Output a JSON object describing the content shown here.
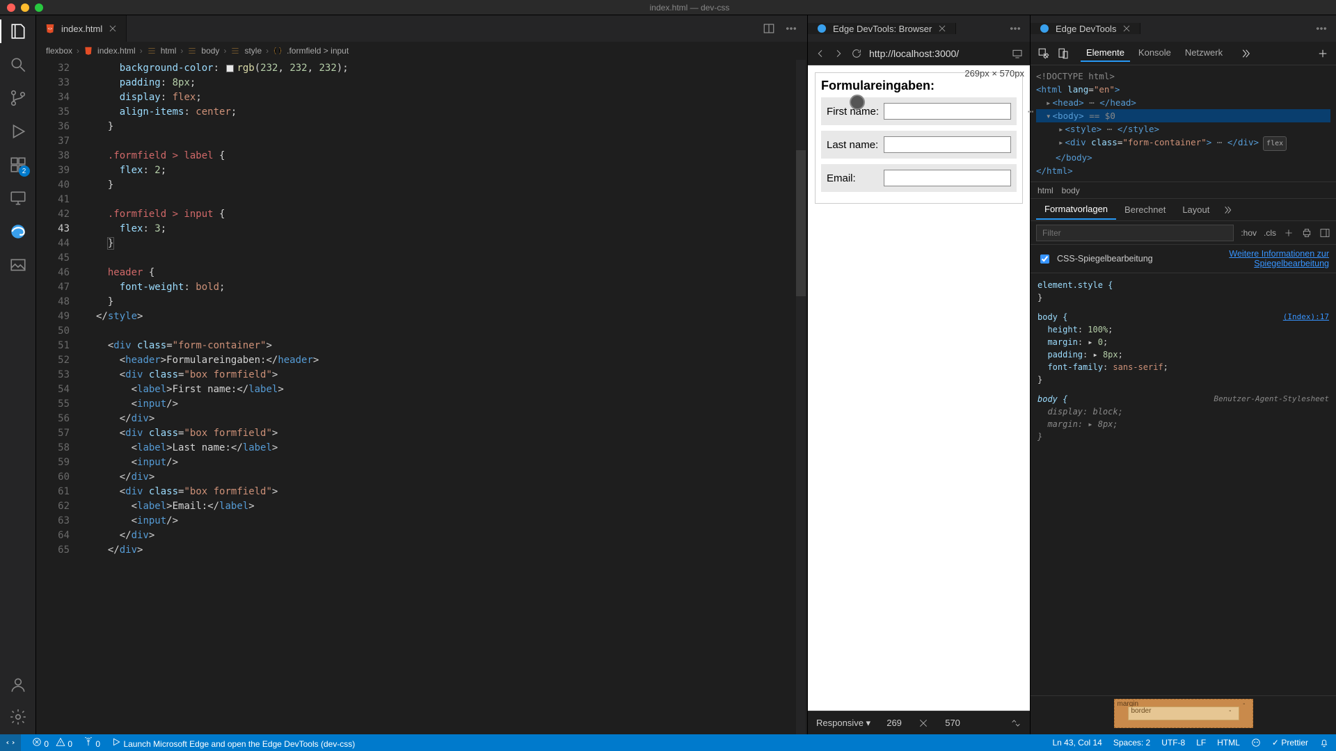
{
  "window": {
    "title": "index.html — dev-css"
  },
  "activitybar": {
    "extensions_badge": "2"
  },
  "editor": {
    "tab": {
      "filename": "index.html"
    },
    "breadcrumb": [
      "flexbox",
      "index.html",
      "html",
      "body",
      "style",
      ".formfield > input"
    ],
    "current_line": 43,
    "lines": {
      "32": [
        {
          "cls": "c-blue",
          "t": "background-color"
        },
        {
          "cls": "c-punc",
          "t": ": "
        },
        {
          "cls": "",
          "t": "",
          "colorbox": true
        },
        {
          "cls": "c-func",
          "t": "rgb"
        },
        {
          "cls": "c-punc",
          "t": "("
        },
        {
          "cls": "c-num",
          "t": "232"
        },
        {
          "cls": "c-punc",
          "t": ", "
        },
        {
          "cls": "c-num",
          "t": "232"
        },
        {
          "cls": "c-punc",
          "t": ", "
        },
        {
          "cls": "c-num",
          "t": "232"
        },
        {
          "cls": "c-punc",
          "t": ");"
        }
      ],
      "33": [
        {
          "cls": "c-blue",
          "t": "padding"
        },
        {
          "cls": "c-punc",
          "t": ": "
        },
        {
          "cls": "c-num",
          "t": "8px"
        },
        {
          "cls": "c-punc",
          "t": ";"
        }
      ],
      "34": [
        {
          "cls": "c-blue",
          "t": "display"
        },
        {
          "cls": "c-punc",
          "t": ": "
        },
        {
          "cls": "c-val",
          "t": "flex"
        },
        {
          "cls": "c-punc",
          "t": ";"
        }
      ],
      "35": [
        {
          "cls": "c-blue",
          "t": "align-items"
        },
        {
          "cls": "c-punc",
          "t": ": "
        },
        {
          "cls": "c-val",
          "t": "center"
        },
        {
          "cls": "c-punc",
          "t": ";"
        }
      ],
      "36": [
        {
          "cls": "c-punc",
          "t": "}"
        }
      ],
      "37": [],
      "38": [
        {
          "cls": "c-red",
          "t": ".formfield > label"
        },
        {
          "cls": "c-punc",
          "t": " {"
        }
      ],
      "39": [
        {
          "cls": "c-blue",
          "t": "flex"
        },
        {
          "cls": "c-punc",
          "t": ": "
        },
        {
          "cls": "c-num",
          "t": "2"
        },
        {
          "cls": "c-punc",
          "t": ";"
        }
      ],
      "40": [
        {
          "cls": "c-punc",
          "t": "}"
        }
      ],
      "41": [],
      "42": [
        {
          "cls": "c-red",
          "t": ".formfield > input"
        },
        {
          "cls": "c-punc",
          "t": " {"
        }
      ],
      "43": [
        {
          "cls": "c-blue",
          "t": "flex"
        },
        {
          "cls": "c-punc",
          "t": ": "
        },
        {
          "cls": "c-num",
          "t": "3"
        },
        {
          "cls": "c-punc",
          "t": ";"
        }
      ],
      "44": [
        {
          "cls": "c-punc sel-brace",
          "t": "}"
        }
      ],
      "45": [],
      "46": [
        {
          "cls": "c-red",
          "t": "header"
        },
        {
          "cls": "c-punc",
          "t": " {"
        }
      ],
      "47": [
        {
          "cls": "c-blue",
          "t": "font-weight"
        },
        {
          "cls": "c-punc",
          "t": ": "
        },
        {
          "cls": "c-val",
          "t": "bold"
        },
        {
          "cls": "c-punc",
          "t": ";"
        }
      ],
      "48": [
        {
          "cls": "c-punc",
          "t": "}"
        }
      ],
      "49": [
        {
          "cls": "c-punc",
          "t": "</"
        },
        {
          "cls": "c-tag",
          "t": "style"
        },
        {
          "cls": "c-punc",
          "t": ">"
        }
      ],
      "50": [],
      "51": [
        {
          "cls": "c-punc",
          "t": "<"
        },
        {
          "cls": "c-tag",
          "t": "div"
        },
        {
          "cls": "c-punc",
          "t": " "
        },
        {
          "cls": "c-blue",
          "t": "class"
        },
        {
          "cls": "c-punc",
          "t": "="
        },
        {
          "cls": "c-val",
          "t": "\"form-container\""
        },
        {
          "cls": "c-punc",
          "t": ">"
        }
      ],
      "52": [
        {
          "cls": "c-punc",
          "t": "<"
        },
        {
          "cls": "c-tag",
          "t": "header"
        },
        {
          "cls": "c-punc",
          "t": ">"
        },
        {
          "cls": "c-punc",
          "t": "Formulareingaben:"
        },
        {
          "cls": "c-punc",
          "t": "</"
        },
        {
          "cls": "c-tag",
          "t": "header"
        },
        {
          "cls": "c-punc",
          "t": ">"
        }
      ],
      "53": [
        {
          "cls": "c-punc",
          "t": "<"
        },
        {
          "cls": "c-tag",
          "t": "div"
        },
        {
          "cls": "c-punc",
          "t": " "
        },
        {
          "cls": "c-blue",
          "t": "class"
        },
        {
          "cls": "c-punc",
          "t": "="
        },
        {
          "cls": "c-val",
          "t": "\"box formfield\""
        },
        {
          "cls": "c-punc",
          "t": ">"
        }
      ],
      "54": [
        {
          "cls": "c-punc",
          "t": "<"
        },
        {
          "cls": "c-tag",
          "t": "label"
        },
        {
          "cls": "c-punc",
          "t": ">"
        },
        {
          "cls": "c-punc",
          "t": "First name:"
        },
        {
          "cls": "c-punc",
          "t": "</"
        },
        {
          "cls": "c-tag",
          "t": "label"
        },
        {
          "cls": "c-punc",
          "t": ">"
        }
      ],
      "55": [
        {
          "cls": "c-punc",
          "t": "<"
        },
        {
          "cls": "c-tag",
          "t": "input"
        },
        {
          "cls": "c-punc",
          "t": "/>"
        }
      ],
      "56": [
        {
          "cls": "c-punc",
          "t": "</"
        },
        {
          "cls": "c-tag",
          "t": "div"
        },
        {
          "cls": "c-punc",
          "t": ">"
        }
      ],
      "57": [
        {
          "cls": "c-punc",
          "t": "<"
        },
        {
          "cls": "c-tag",
          "t": "div"
        },
        {
          "cls": "c-punc",
          "t": " "
        },
        {
          "cls": "c-blue",
          "t": "class"
        },
        {
          "cls": "c-punc",
          "t": "="
        },
        {
          "cls": "c-val",
          "t": "\"box formfield\""
        },
        {
          "cls": "c-punc",
          "t": ">"
        }
      ],
      "58": [
        {
          "cls": "c-punc",
          "t": "<"
        },
        {
          "cls": "c-tag",
          "t": "label"
        },
        {
          "cls": "c-punc",
          "t": ">"
        },
        {
          "cls": "c-punc",
          "t": "Last name:"
        },
        {
          "cls": "c-punc",
          "t": "</"
        },
        {
          "cls": "c-tag",
          "t": "label"
        },
        {
          "cls": "c-punc",
          "t": ">"
        }
      ],
      "59": [
        {
          "cls": "c-punc",
          "t": "<"
        },
        {
          "cls": "c-tag",
          "t": "input"
        },
        {
          "cls": "c-punc",
          "t": "/>"
        }
      ],
      "60": [
        {
          "cls": "c-punc",
          "t": "</"
        },
        {
          "cls": "c-tag",
          "t": "div"
        },
        {
          "cls": "c-punc",
          "t": ">"
        }
      ],
      "61": [
        {
          "cls": "c-punc",
          "t": "<"
        },
        {
          "cls": "c-tag",
          "t": "div"
        },
        {
          "cls": "c-punc",
          "t": " "
        },
        {
          "cls": "c-blue",
          "t": "class"
        },
        {
          "cls": "c-punc",
          "t": "="
        },
        {
          "cls": "c-val",
          "t": "\"box formfield\""
        },
        {
          "cls": "c-punc",
          "t": ">"
        }
      ],
      "62": [
        {
          "cls": "c-punc",
          "t": "<"
        },
        {
          "cls": "c-tag",
          "t": "label"
        },
        {
          "cls": "c-punc",
          "t": ">"
        },
        {
          "cls": "c-punc",
          "t": "Email:"
        },
        {
          "cls": "c-punc",
          "t": "</"
        },
        {
          "cls": "c-tag",
          "t": "label"
        },
        {
          "cls": "c-punc",
          "t": ">"
        }
      ],
      "63": [
        {
          "cls": "c-punc",
          "t": "<"
        },
        {
          "cls": "c-tag",
          "t": "input"
        },
        {
          "cls": "c-punc",
          "t": "/>"
        }
      ],
      "64": [
        {
          "cls": "c-punc",
          "t": "</"
        },
        {
          "cls": "c-tag",
          "t": "div"
        },
        {
          "cls": "c-punc",
          "t": ">"
        }
      ],
      "65": [
        {
          "cls": "c-punc",
          "t": "</"
        },
        {
          "cls": "c-tag",
          "t": "div"
        },
        {
          "cls": "c-punc",
          "t": ">"
        }
      ]
    },
    "indent": {
      "32": "    ",
      "33": "    ",
      "34": "    ",
      "35": "    ",
      "36": "  ",
      "37": "",
      "38": "  ",
      "39": "    ",
      "40": "  ",
      "41": "",
      "42": "  ",
      "43": "    ",
      "44": "  ",
      "45": "",
      "46": "  ",
      "47": "    ",
      "48": "  ",
      "49": "",
      "50": "",
      "51": "  ",
      "52": "    ",
      "53": "    ",
      "54": "      ",
      "55": "      ",
      "56": "    ",
      "57": "    ",
      "58": "      ",
      "59": "      ",
      "60": "    ",
      "61": "    ",
      "62": "      ",
      "63": "      ",
      "64": "    ",
      "65": "  "
    }
  },
  "browser": {
    "tab_title": "Edge DevTools: Browser",
    "url": "http://localhost:3000/",
    "dimensions": "269px × 570px",
    "page": {
      "heading": "Formulareingaben:",
      "fields": [
        {
          "label": "First name:"
        },
        {
          "label": "Last name:"
        },
        {
          "label": "Email:"
        }
      ]
    },
    "responsive": {
      "mode": "Responsive",
      "w": "269",
      "h": "570"
    }
  },
  "devtools": {
    "tab_title": "Edge DevTools",
    "tabs": [
      "Elemente",
      "Konsole",
      "Netzwerk"
    ],
    "active_tab": "Elemente",
    "dom": {
      "doctype": "<!DOCTYPE html>",
      "html_open": "<html lang=\"en\">",
      "head": "<head> ⋯ </head>",
      "body_open": "<body>",
      "body_info": "== $0",
      "style": "<style> ⋯ </style>",
      "div_open": "<div class=\"form-container\"> ⋯ </div>",
      "flex_pill": "flex",
      "body_close": "</body>",
      "html_close": "</html>"
    },
    "crumbs": [
      "html",
      "body"
    ],
    "styles_tabs": [
      "Formatvorlagen",
      "Berechnet",
      "Layout"
    ],
    "filter_placeholder": "Filter",
    "chips": {
      "hov": ":hov",
      "cls": ".cls"
    },
    "mirror": {
      "label": "CSS-Spiegelbearbeitung",
      "link1": "Weitere Informationen zur",
      "link2": "Spiegelbearbeitung"
    },
    "rules": {
      "element_style": "element.style {",
      "body_rule": {
        "sel": "body {",
        "src": "(Index):17",
        "decls": [
          {
            "p": "height",
            "v": "100%"
          },
          {
            "p": "margin",
            "v": "0",
            "tw": true
          },
          {
            "p": "padding",
            "v": "8px",
            "tw": true
          },
          {
            "p": "font-family",
            "v": "sans-serif"
          }
        ]
      },
      "ua_rule": {
        "sel": "body {",
        "src": "Benutzer-Agent-Stylesheet",
        "decls": [
          {
            "p": "display",
            "v": "block"
          },
          {
            "p": "margin",
            "v": "8px",
            "tw": true
          }
        ]
      }
    },
    "boxmodel": {
      "margin": "margin",
      "border": "border",
      "dash": "-"
    }
  },
  "statusbar": {
    "errors": "0",
    "warnings": "0",
    "ports": "0",
    "launch": "Launch Microsoft Edge and open the Edge DevTools (dev-css)",
    "cursor": "Ln 43, Col 14",
    "spaces": "Spaces: 2",
    "enc": "UTF-8",
    "eol": "LF",
    "lang": "HTML",
    "prettier": "Prettier"
  }
}
